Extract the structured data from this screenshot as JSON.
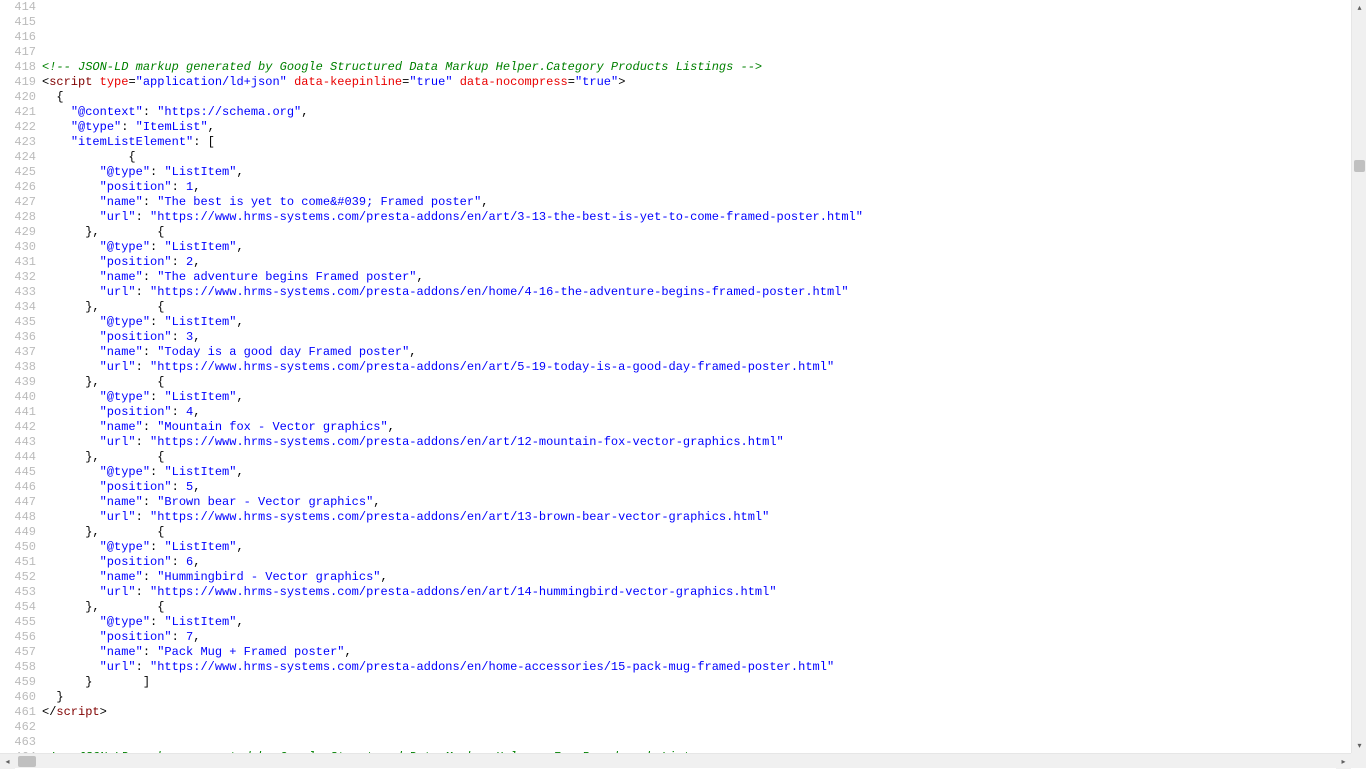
{
  "gutter": {
    "first_line": 414,
    "last_line": 464
  },
  "lines": [
    {
      "kind": "blank",
      "text": ""
    },
    {
      "kind": "blank",
      "text": ""
    },
    {
      "kind": "blank",
      "text": ""
    },
    {
      "kind": "blank",
      "text": ""
    },
    {
      "kind": "comment",
      "text": "<!-- JSON-LD markup generated by Google Structured Data Markup Helper.Category Products Listings -->"
    },
    {
      "kind": "script-open",
      "tag": "script",
      "attrs": [
        {
          "name": "type",
          "value": "application/ld+json"
        },
        {
          "name": "data-keepinline",
          "value": "true"
        },
        {
          "name": "data-nocompress",
          "value": "true"
        }
      ]
    },
    {
      "kind": "plain",
      "text": "  {"
    },
    {
      "kind": "kv",
      "indent": "    ",
      "key": "\"@context\"",
      "val": "\"https://schema.org\"",
      "after": ","
    },
    {
      "kind": "kv",
      "indent": "    ",
      "key": "\"@type\"",
      "val": "\"ItemList\"",
      "after": ","
    },
    {
      "kind": "kv-open",
      "indent": "    ",
      "key": "\"itemListElement\"",
      "after": ": ["
    },
    {
      "kind": "plain",
      "text": "            {"
    },
    {
      "kind": "kv",
      "indent": "        ",
      "key": "\"@type\"",
      "val": "\"ListItem\"",
      "after": ","
    },
    {
      "kind": "kv",
      "indent": "        ",
      "key": "\"position\"",
      "val": "1",
      "after": ","
    },
    {
      "kind": "kv",
      "indent": "        ",
      "key": "\"name\"",
      "val": "\"The best is yet to come&#039; Framed poster\"",
      "after": ","
    },
    {
      "kind": "kv",
      "indent": "        ",
      "key": "\"url\"",
      "val": "\"https://www.hrms-systems.com/presta-addons/en/art/3-13-the-best-is-yet-to-come-framed-poster.html\"",
      "after": ""
    },
    {
      "kind": "plain",
      "text": "      },        {"
    },
    {
      "kind": "kv",
      "indent": "        ",
      "key": "\"@type\"",
      "val": "\"ListItem\"",
      "after": ","
    },
    {
      "kind": "kv",
      "indent": "        ",
      "key": "\"position\"",
      "val": "2",
      "after": ","
    },
    {
      "kind": "kv",
      "indent": "        ",
      "key": "\"name\"",
      "val": "\"The adventure begins Framed poster\"",
      "after": ","
    },
    {
      "kind": "kv",
      "indent": "        ",
      "key": "\"url\"",
      "val": "\"https://www.hrms-systems.com/presta-addons/en/home/4-16-the-adventure-begins-framed-poster.html\"",
      "after": ""
    },
    {
      "kind": "plain",
      "text": "      },        {"
    },
    {
      "kind": "kv",
      "indent": "        ",
      "key": "\"@type\"",
      "val": "\"ListItem\"",
      "after": ","
    },
    {
      "kind": "kv",
      "indent": "        ",
      "key": "\"position\"",
      "val": "3",
      "after": ","
    },
    {
      "kind": "kv",
      "indent": "        ",
      "key": "\"name\"",
      "val": "\"Today is a good day Framed poster\"",
      "after": ","
    },
    {
      "kind": "kv",
      "indent": "        ",
      "key": "\"url\"",
      "val": "\"https://www.hrms-systems.com/presta-addons/en/art/5-19-today-is-a-good-day-framed-poster.html\"",
      "after": ""
    },
    {
      "kind": "plain",
      "text": "      },        {"
    },
    {
      "kind": "kv",
      "indent": "        ",
      "key": "\"@type\"",
      "val": "\"ListItem\"",
      "after": ","
    },
    {
      "kind": "kv",
      "indent": "        ",
      "key": "\"position\"",
      "val": "4",
      "after": ","
    },
    {
      "kind": "kv",
      "indent": "        ",
      "key": "\"name\"",
      "val": "\"Mountain fox - Vector graphics\"",
      "after": ","
    },
    {
      "kind": "kv",
      "indent": "        ",
      "key": "\"url\"",
      "val": "\"https://www.hrms-systems.com/presta-addons/en/art/12-mountain-fox-vector-graphics.html\"",
      "after": ""
    },
    {
      "kind": "plain",
      "text": "      },        {"
    },
    {
      "kind": "kv",
      "indent": "        ",
      "key": "\"@type\"",
      "val": "\"ListItem\"",
      "after": ","
    },
    {
      "kind": "kv",
      "indent": "        ",
      "key": "\"position\"",
      "val": "5",
      "after": ","
    },
    {
      "kind": "kv",
      "indent": "        ",
      "key": "\"name\"",
      "val": "\"Brown bear - Vector graphics\"",
      "after": ","
    },
    {
      "kind": "kv",
      "indent": "        ",
      "key": "\"url\"",
      "val": "\"https://www.hrms-systems.com/presta-addons/en/art/13-brown-bear-vector-graphics.html\"",
      "after": ""
    },
    {
      "kind": "plain",
      "text": "      },        {"
    },
    {
      "kind": "kv",
      "indent": "        ",
      "key": "\"@type\"",
      "val": "\"ListItem\"",
      "after": ","
    },
    {
      "kind": "kv",
      "indent": "        ",
      "key": "\"position\"",
      "val": "6",
      "after": ","
    },
    {
      "kind": "kv",
      "indent": "        ",
      "key": "\"name\"",
      "val": "\"Hummingbird - Vector graphics\"",
      "after": ","
    },
    {
      "kind": "kv",
      "indent": "        ",
      "key": "\"url\"",
      "val": "\"https://www.hrms-systems.com/presta-addons/en/art/14-hummingbird-vector-graphics.html\"",
      "after": ""
    },
    {
      "kind": "plain",
      "text": "      },        {"
    },
    {
      "kind": "kv",
      "indent": "        ",
      "key": "\"@type\"",
      "val": "\"ListItem\"",
      "after": ","
    },
    {
      "kind": "kv",
      "indent": "        ",
      "key": "\"position\"",
      "val": "7",
      "after": ","
    },
    {
      "kind": "kv",
      "indent": "        ",
      "key": "\"name\"",
      "val": "\"Pack Mug + Framed poster\"",
      "after": ","
    },
    {
      "kind": "kv",
      "indent": "        ",
      "key": "\"url\"",
      "val": "\"https://www.hrms-systems.com/presta-addons/en/home-accessories/15-pack-mug-framed-poster.html\"",
      "after": ""
    },
    {
      "kind": "plain",
      "text": "      }       ]"
    },
    {
      "kind": "plain",
      "text": "  }"
    },
    {
      "kind": "script-close",
      "tag": "script"
    },
    {
      "kind": "blank",
      "text": ""
    },
    {
      "kind": "blank",
      "text": ""
    },
    {
      "kind": "comment-partial",
      "text": "<!-- JSON-LD markup generated by Google Structured Data Markup Helper. For Breadcrumb List -->"
    }
  ],
  "scroll": {
    "labels": {
      "up": "▴",
      "down": "▾",
      "left": "◂",
      "right": "▸"
    }
  }
}
